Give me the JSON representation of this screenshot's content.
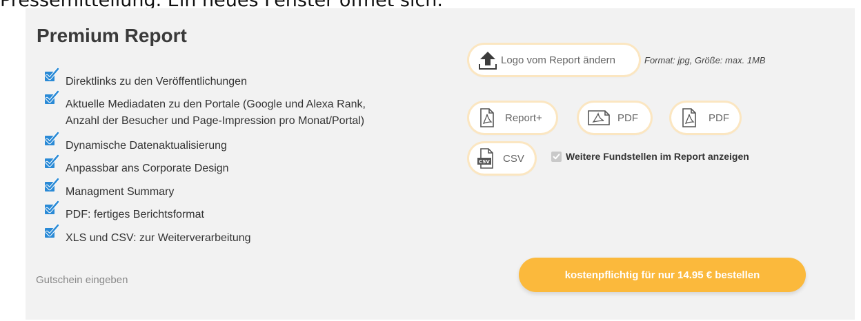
{
  "page": {
    "top_text": "Pressemitteilung. Ein neues Fenster öffnet sich."
  },
  "report": {
    "title": "Premium Report",
    "features": [
      "Direktlinks zu den Veröffentlichungen",
      "Aktuelle Mediadaten zu den Portale (Google und Alexa Rank,",
      "Anzahl der Besucher und Page-Impression pro Monat/Portal)",
      "Dynamische Datenaktualisierung",
      "Anpassbar ans Corporate Design",
      "Managment Summary",
      "PDF: fertiges Berichtsformat",
      "XLS und CSV: zur Weiterverarbeitung"
    ],
    "coupon_link": "Gutschein eingeben"
  },
  "logo": {
    "button_label": "Logo vom Report ändern",
    "format_hint": "Format: jpg, Größe: max. 1MB"
  },
  "formats": {
    "report_plus": "Report+",
    "pdf_landscape": "PDF",
    "pdf_portrait": "PDF",
    "csv": "CSV"
  },
  "options": {
    "more_findings_label": "Weitere Fundstellen im Report anzeigen",
    "more_findings_checked": true
  },
  "order": {
    "button_label": "kostenpflichtig für nur 14.95 € bestellen"
  },
  "colors": {
    "accent_orange": "#fbb93c",
    "check_blue": "#2a8ad6",
    "panel_bg": "#f2f2f2"
  }
}
